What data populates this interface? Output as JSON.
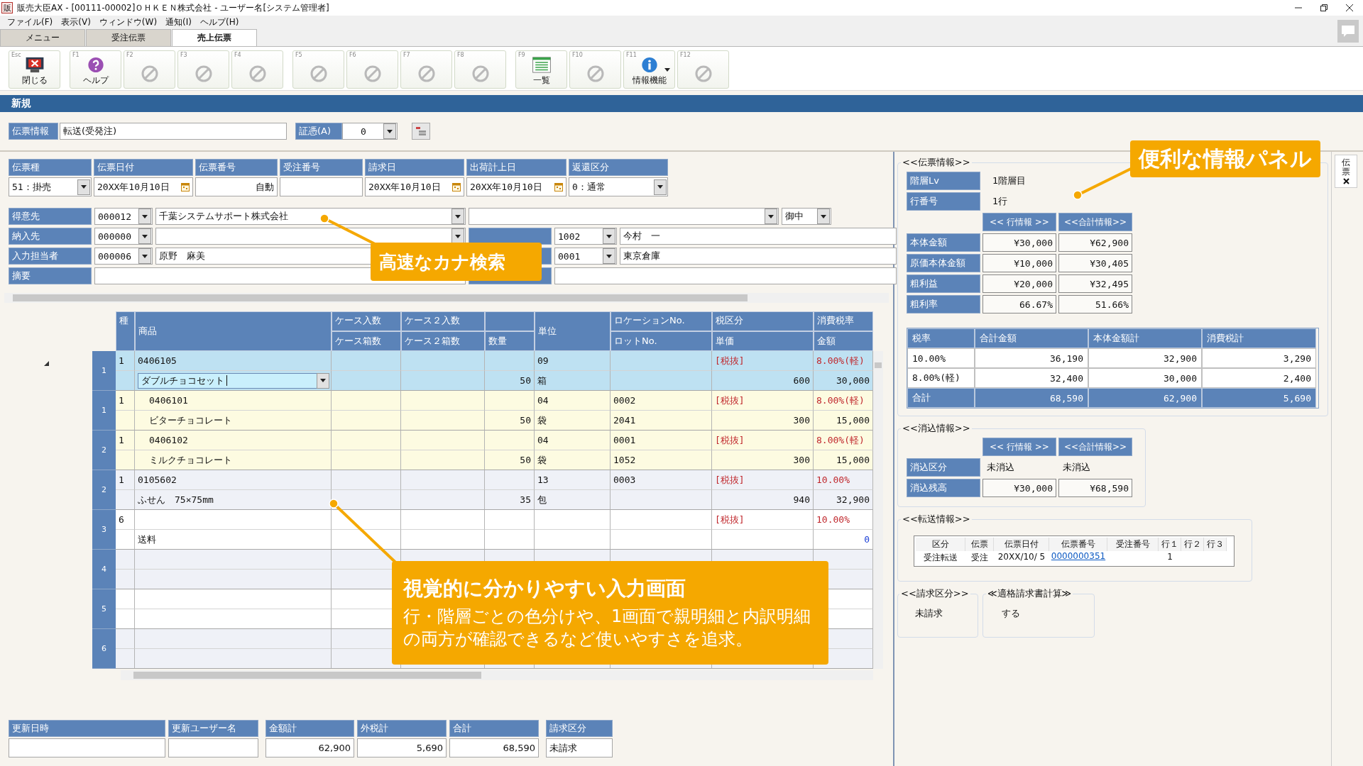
{
  "window": {
    "app_icon": "販",
    "title": "販売大臣AX - [00111-00002]ＯＨＫＥＮ株式会社 - ユーザー名[システム管理者]"
  },
  "menu": [
    "ファイル(F)",
    "表示(V)",
    "ウィンドウ(W)",
    "通知(I)",
    "ヘルプ(H)"
  ],
  "tabs": [
    {
      "label": "メニュー",
      "selected": false
    },
    {
      "label": "受注伝票",
      "selected": false
    },
    {
      "label": "売上伝票",
      "selected": true
    }
  ],
  "toolbar": {
    "groups": [
      [
        {
          "key": "Esc",
          "label": "閉じる",
          "kind": "close",
          "dropdown": false
        }
      ],
      [
        {
          "key": "F1",
          "label": "ヘルプ",
          "kind": "help",
          "dropdown": false
        },
        {
          "key": "F2",
          "kind": "disabled",
          "dropdown": false
        },
        {
          "key": "F3",
          "kind": "disabled",
          "dropdown": false
        },
        {
          "key": "F4",
          "kind": "disabled",
          "dropdown": false
        }
      ],
      [
        {
          "key": "F5",
          "kind": "disabled",
          "dropdown": false
        },
        {
          "key": "F6",
          "kind": "disabled",
          "dropdown": false
        },
        {
          "key": "F7",
          "kind": "disabled",
          "dropdown": false
        },
        {
          "key": "F8",
          "kind": "disabled",
          "dropdown": false
        }
      ],
      [
        {
          "key": "F9",
          "label": "一覧",
          "kind": "list",
          "dropdown": false
        },
        {
          "key": "F10",
          "kind": "disabled",
          "dropdown": false
        },
        {
          "key": "F11",
          "label": "情報機能",
          "kind": "info",
          "dropdown": true
        },
        {
          "key": "F12",
          "kind": "disabled",
          "dropdown": false
        }
      ]
    ]
  },
  "mode_banner": "新規",
  "slip_info": {
    "label": "伝票情報",
    "value": "転送(受発注)",
    "voucher_label": "証憑(A)",
    "voucher_value": "0"
  },
  "header_fields": [
    {
      "label": "伝票種",
      "kind": "select",
      "value": "51：掛売"
    },
    {
      "label": "伝票日付",
      "kind": "date",
      "value": "20XX年10月10日"
    },
    {
      "label": "伝票番号",
      "kind": "number",
      "value": "自動"
    },
    {
      "label": "受注番号",
      "kind": "text"
    },
    {
      "label": "請求日",
      "kind": "date",
      "value": "20XX年10月10日"
    },
    {
      "label": "出荷計上日",
      "kind": "date",
      "value": "20XX年10月10日"
    },
    {
      "label": "返還区分",
      "kind": "select",
      "value": "0：通常"
    }
  ],
  "party_rows": [
    {
      "label": "得意先",
      "kind": "code",
      "code": "000012",
      "name": "千葉システムサポート株式会社"
    },
    {
      "label": "納入先",
      "kind": "code",
      "code": "000000"
    },
    {
      "label": "入力担当者",
      "kind": "code",
      "code": "000006",
      "name": "原野　麻美"
    },
    {
      "label": "摘要",
      "kind": "text"
    }
  ],
  "party_side_rows": [
    {
      "kind": "destination",
      "honorific": "御中"
    },
    {
      "kind": "code",
      "code": "1002",
      "name": "今村　一"
    },
    {
      "kind": "code",
      "code": "0001",
      "name": "東京倉庫"
    },
    {
      "kind": "text"
    }
  ],
  "detail_grid": {
    "columns": [
      {
        "top": "種"
      },
      {
        "top": "商品"
      },
      {
        "top": "ケース入数",
        "bottom": "ケース箱数"
      },
      {
        "top": "ケース２入数",
        "bottom": "ケース２箱数"
      },
      {
        "bottom": "数量"
      },
      {
        "top": "単位"
      },
      {
        "top": "ロケーションNo.",
        "bottom": "ロットNo."
      },
      {
        "top": "税区分",
        "bottom": "単価"
      },
      {
        "top": "消費税率",
        "bottom": "金額"
      }
    ],
    "rows": [
      {
        "no": "1",
        "selected": true,
        "type": "1",
        "code": "0406105",
        "unit_code": "09",
        "tax_class": "[税抜]",
        "tax_rate": "8.00%(軽)",
        "name": "ダブルチョコセット",
        "quantity": "50",
        "unit": "箱",
        "unit_price": "600",
        "amount": "30,000",
        "amount_emphasis": false,
        "children": [
          {
            "no": "1",
            "selected": false,
            "type": "1",
            "code": "0406101",
            "unit_code": "04",
            "location": "0002",
            "tax_class": "[税抜]",
            "tax_rate": "8.00%(軽)",
            "name": "ビターチョコレート",
            "quantity": "50",
            "unit": "袋",
            "lot": "2041",
            "unit_price": "300",
            "amount": "15,000",
            "amount_emphasis": false
          },
          {
            "no": "2",
            "selected": false,
            "type": "1",
            "code": "0406102",
            "unit_code": "04",
            "location": "0001",
            "tax_class": "[税抜]",
            "tax_rate": "8.00%(軽)",
            "name": "ミルクチョコレート",
            "quantity": "50",
            "unit": "袋",
            "lot": "1052",
            "unit_price": "300",
            "amount": "15,000",
            "amount_emphasis": false
          }
        ]
      },
      {
        "no": "2",
        "selected": false,
        "type": "1",
        "code": "0105602",
        "unit_code": "13",
        "location": "0003",
        "tax_class": "[税抜]",
        "tax_rate": "10.00%",
        "name": "ふせん　75×75mm",
        "quantity": "35",
        "unit": "包",
        "unit_price": "940",
        "amount": "32,900",
        "amount_emphasis": false
      },
      {
        "no": "3",
        "selected": false,
        "type": "6",
        "tax_class": "[税抜]",
        "tax_rate": "10.00%",
        "name": "送料",
        "amount": "0",
        "amount_emphasis": true
      },
      {
        "no": "4",
        "selected": false
      },
      {
        "no": "5",
        "selected": false
      },
      {
        "no": "6",
        "selected": false
      }
    ]
  },
  "footer_fields": [
    {
      "label": "更新日時",
      "kind": "text"
    },
    {
      "label": "更新ユーザー名",
      "kind": "text"
    },
    {
      "label": "金額計",
      "kind": "amount",
      "value": "62,900"
    },
    {
      "label": "外税計",
      "kind": "amount",
      "value": "5,690"
    },
    {
      "label": "合計",
      "kind": "amount",
      "value": "68,590"
    },
    {
      "label": "請求区分",
      "kind": "text",
      "value": "未請求"
    }
  ],
  "slip_panel": {
    "title": "<<伝票情報>>",
    "info": [
      {
        "label": "階層Lv",
        "value": "1階層目"
      },
      {
        "label": "行番号",
        "value": "1行"
      }
    ],
    "column_heads": [
      "<< 行情報 >>",
      "<<合計情報>>"
    ],
    "figures": [
      {
        "label": "本体金額",
        "line": "¥30,000",
        "total": "¥62,900"
      },
      {
        "label": "原価本体金額",
        "line": "¥10,000",
        "total": "¥30,405"
      },
      {
        "label": "粗利益",
        "line": "¥20,000",
        "total": "¥32,495"
      },
      {
        "label": "粗利率",
        "line": "66.67%",
        "total": "51.66%"
      }
    ],
    "tax_table": {
      "columns": [
        "税率",
        "合計金額",
        "本体金額計",
        "消費税計"
      ],
      "rows": [
        {
          "kind": "rate",
          "cells": [
            "10.00%",
            "36,190",
            "32,900",
            "3,290"
          ]
        },
        {
          "kind": "rate",
          "cells": [
            "8.00%(軽)",
            "32,400",
            "30,000",
            "2,400"
          ]
        },
        {
          "kind": "total",
          "cells": [
            "合計",
            "68,590",
            "62,900",
            "5,690"
          ]
        }
      ]
    }
  },
  "clearing_panel": {
    "title": "<<消込情報>>",
    "column_heads": [
      "<< 行情報 >>",
      "<<合計情報>>"
    ],
    "rows": [
      {
        "kind": "plain",
        "label": "消込区分",
        "line": "未消込",
        "total": "未消込"
      },
      {
        "kind": "boxed",
        "label": "消込残高",
        "line": "¥30,000",
        "total": "¥68,590"
      }
    ]
  },
  "transfer_panel": {
    "title": "<<転送情報>>",
    "columns": [
      "区分",
      "伝票",
      "伝票日付",
      "伝票番号",
      "受注番号",
      "行１",
      "行２",
      "行３"
    ],
    "rows": [
      {
        "division": "受注転送",
        "slip": "受注",
        "date": "20XX/10/ 5",
        "number": "0000000351",
        "line_1": "1"
      }
    ]
  },
  "billing_panel": {
    "title": "<<請求区分>>",
    "value": "未請求"
  },
  "invoice_panel": {
    "title": "≪適格請求書計算≫",
    "value": "する"
  },
  "side_tab": {
    "label": "伝票"
  },
  "callouts": [
    {
      "title": "高速なカナ検索"
    },
    {
      "title": "便利な情報パネル"
    },
    {
      "title": "視覚的に分かりやすい入力画面",
      "body": "行・階層ごとの色分けや、1画面で親明細と内訳明細の両方が確認できるなど使いやすさを追求。"
    }
  ]
}
